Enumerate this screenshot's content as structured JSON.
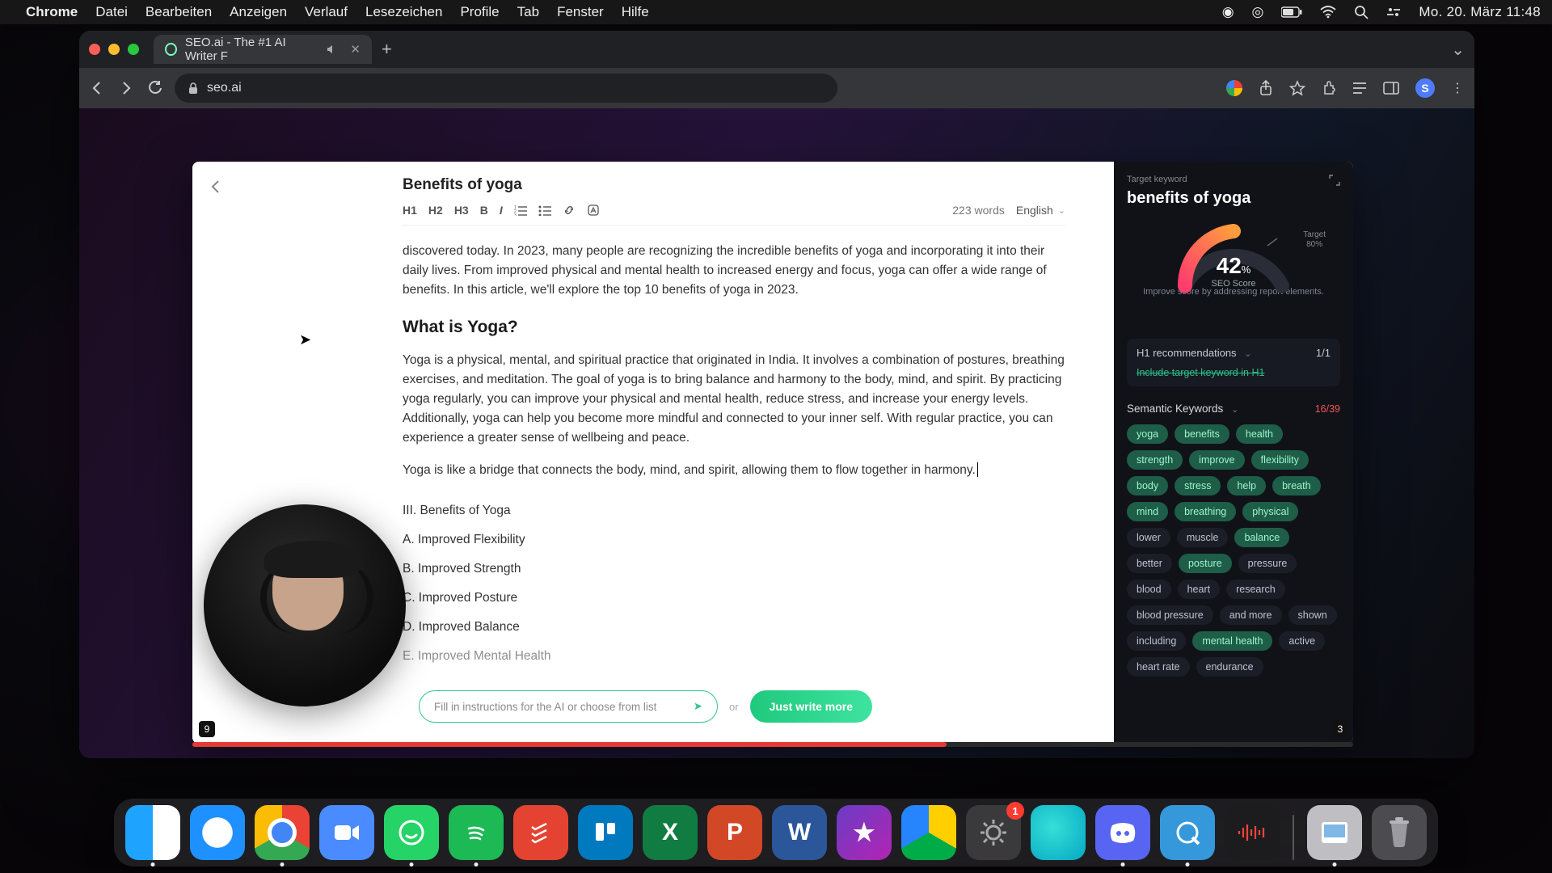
{
  "menubar": {
    "app": "Chrome",
    "items": [
      "Datei",
      "Bearbeiten",
      "Anzeigen",
      "Verlauf",
      "Lesezeichen",
      "Profile",
      "Tab",
      "Fenster",
      "Hilfe"
    ],
    "clock": "Mo. 20. März  11:48"
  },
  "browser": {
    "tab_title": "SEO.ai - The #1 AI Writer F",
    "url": "seo.ai",
    "avatar_initial": "S"
  },
  "editor": {
    "title": "Benefits of yoga",
    "toolbar": {
      "h1": "H1",
      "h2": "H2",
      "h3": "H3",
      "bold": "B",
      "italic": "I"
    },
    "word_count": "223 words",
    "language": "English",
    "para_intro": "discovered today. In 2023, many people are recognizing the incredible benefits of yoga and incorporating it into their daily lives. From improved physical and mental health to increased energy and focus, yoga can offer a wide range of benefits. In this article, we'll explore the top 10 benefits of yoga in 2023.",
    "heading_what": "What is Yoga?",
    "para_what": "Yoga is a physical, mental, and spiritual practice that originated in India. It involves a combination of postures, breathing exercises, and meditation. The goal of yoga is to bring balance and harmony to the body, mind, and spirit. By practicing yoga regularly, you can improve your physical and mental health, reduce stress, and increase your energy levels. Additionally, yoga can help you become more mindful and connected to your inner self. With regular practice, you can experience a greater sense of wellbeing and peace.",
    "para_bridge": "Yoga is like a bridge that connects the body, mind, and spirit, allowing them to flow together in harmony.",
    "outline": [
      "III. Benefits of Yoga",
      "A. Improved Flexibility",
      "B. Improved Strength",
      "C. Improved Posture",
      "D. Improved Balance",
      "E. Improved Mental Health"
    ],
    "ai_placeholder": "Fill in instructions for the AI or choose from list",
    "ai_or": "or",
    "ai_button": "Just write more"
  },
  "panel": {
    "target_label": "Target keyword",
    "keyword": "benefits of yoga",
    "score": "42",
    "score_unit": "%",
    "score_caption": "SEO Score",
    "target_pct": "80%",
    "target_caption": "Target",
    "hint": "Improve score by addressing report elements.",
    "h1_section": "H1 recommendations",
    "h1_count": "1/1",
    "h1_item": "Include target keyword in H1",
    "sk_section": "Semantic Keywords",
    "sk_count": "16/39",
    "keywords": [
      {
        "t": "yoga",
        "on": true
      },
      {
        "t": "benefits",
        "on": true
      },
      {
        "t": "health",
        "on": true
      },
      {
        "t": "strength",
        "on": true
      },
      {
        "t": "improve",
        "on": true
      },
      {
        "t": "flexibility",
        "on": true
      },
      {
        "t": "body",
        "on": true
      },
      {
        "t": "stress",
        "on": true
      },
      {
        "t": "help",
        "on": true
      },
      {
        "t": "breath",
        "on": true
      },
      {
        "t": "mind",
        "on": true
      },
      {
        "t": "breathing",
        "on": true
      },
      {
        "t": "physical",
        "on": true
      },
      {
        "t": "lower",
        "on": false
      },
      {
        "t": "muscle",
        "on": false
      },
      {
        "t": "balance",
        "on": true
      },
      {
        "t": "better",
        "on": false
      },
      {
        "t": "posture",
        "on": true
      },
      {
        "t": "pressure",
        "on": false
      },
      {
        "t": "blood",
        "on": false
      },
      {
        "t": "heart",
        "on": false
      },
      {
        "t": "research",
        "on": false
      },
      {
        "t": "blood pressure",
        "on": false
      },
      {
        "t": "and more",
        "on": false
      },
      {
        "t": "shown",
        "on": false
      },
      {
        "t": "including",
        "on": false
      },
      {
        "t": "mental health",
        "on": true
      },
      {
        "t": "active",
        "on": false
      },
      {
        "t": "heart rate",
        "on": false
      },
      {
        "t": "endurance",
        "on": false
      }
    ]
  },
  "video": {
    "badge_left": "9",
    "badge_right": "3"
  },
  "dock": {
    "settings_badge": "1",
    "items": [
      "finder",
      "safari",
      "chrome",
      "zoom",
      "whatsapp",
      "spotify",
      "todoist",
      "trello",
      "excel",
      "powerpoint",
      "word",
      "imovie",
      "drive",
      "settings",
      "siri",
      "discord",
      "quicktime",
      "voice-memos",
      "preview",
      "trash"
    ]
  }
}
